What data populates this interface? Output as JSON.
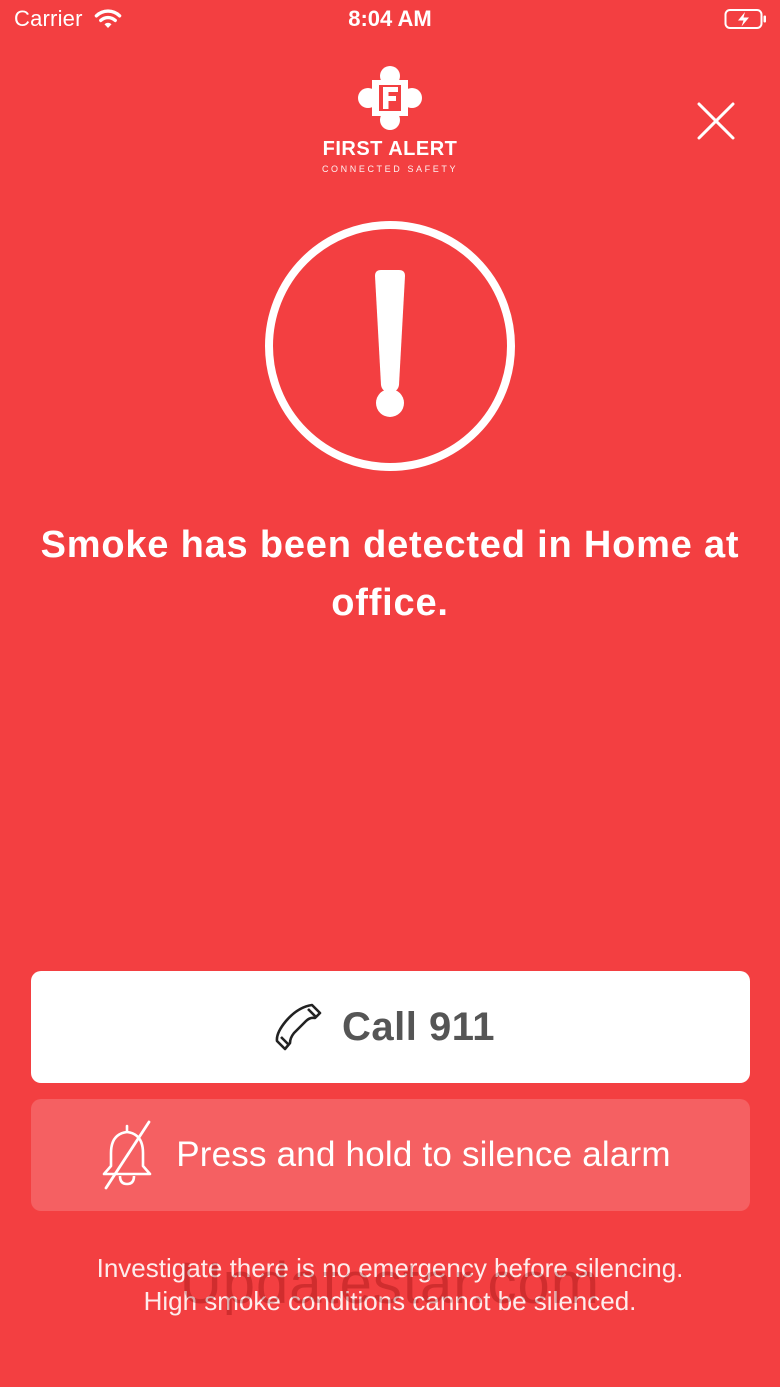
{
  "status_bar": {
    "carrier": "Carrier",
    "time": "8:04 AM",
    "icons": [
      "wifi-icon",
      "battery-charging-icon"
    ]
  },
  "logo": {
    "title": "FIRST ALERT",
    "subtitle": "CONNECTED SAFETY",
    "icon": "first-alert-maltese-cross-icon"
  },
  "close": {
    "icon": "close-icon"
  },
  "alert": {
    "icon": "exclamation-circle-icon",
    "message": "Smoke has been detected in Home at office."
  },
  "call_button": {
    "label": "Call 911",
    "icon": "phone-icon"
  },
  "silence_button": {
    "label": "Press and hold to silence alarm",
    "icon": "bell-off-icon"
  },
  "disclaimer": {
    "line1": "Investigate there is no emergency before silencing.",
    "line2": "High smoke conditions cannot be silenced."
  },
  "watermark": "Updatestar.com",
  "colors": {
    "background": "#f33f41",
    "call_button_bg": "#ffffff",
    "call_text": "#555555",
    "silence_button_bg": "#f56062"
  }
}
